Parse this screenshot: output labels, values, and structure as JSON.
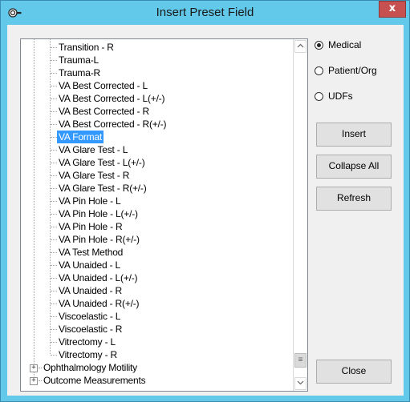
{
  "window": {
    "title": "Insert Preset Field",
    "icon": "key-icon",
    "close_label": "x"
  },
  "tree": {
    "items": [
      {
        "label": "Transition - R",
        "level": 2,
        "selected": false
      },
      {
        "label": "Trauma-L",
        "level": 2,
        "selected": false
      },
      {
        "label": "Trauma-R",
        "level": 2,
        "selected": false
      },
      {
        "label": "VA Best Corrected - L",
        "level": 2,
        "selected": false
      },
      {
        "label": "VA Best Corrected - L(+/-)",
        "level": 2,
        "selected": false
      },
      {
        "label": "VA Best Corrected - R",
        "level": 2,
        "selected": false
      },
      {
        "label": "VA Best Corrected - R(+/-)",
        "level": 2,
        "selected": false
      },
      {
        "label": "VA Format",
        "level": 2,
        "selected": true
      },
      {
        "label": "VA Glare Test - L",
        "level": 2,
        "selected": false
      },
      {
        "label": "VA Glare Test - L(+/-)",
        "level": 2,
        "selected": false
      },
      {
        "label": "VA Glare Test - R",
        "level": 2,
        "selected": false
      },
      {
        "label": "VA Glare Test - R(+/-)",
        "level": 2,
        "selected": false
      },
      {
        "label": "VA Pin Hole - L",
        "level": 2,
        "selected": false
      },
      {
        "label": "VA Pin Hole - L(+/-)",
        "level": 2,
        "selected": false
      },
      {
        "label": "VA Pin Hole - R",
        "level": 2,
        "selected": false
      },
      {
        "label": "VA Pin Hole - R(+/-)",
        "level": 2,
        "selected": false
      },
      {
        "label": "VA Test Method",
        "level": 2,
        "selected": false
      },
      {
        "label": "VA Unaided - L",
        "level": 2,
        "selected": false
      },
      {
        "label": "VA Unaided - L(+/-)",
        "level": 2,
        "selected": false
      },
      {
        "label": "VA Unaided - R",
        "level": 2,
        "selected": false
      },
      {
        "label": "VA Unaided - R(+/-)",
        "level": 2,
        "selected": false
      },
      {
        "label": "Viscoelastic - L",
        "level": 2,
        "selected": false
      },
      {
        "label": "Viscoelastic - R",
        "level": 2,
        "selected": false
      },
      {
        "label": "Vitrectomy - L",
        "level": 2,
        "selected": false
      },
      {
        "label": "Vitrectomy - R",
        "level": 2,
        "selected": false
      },
      {
        "label": "Ophthalmology Motility",
        "level": 1,
        "expander": "+",
        "selected": false
      },
      {
        "label": "Outcome Measurements",
        "level": 1,
        "expander": "+",
        "selected": false
      }
    ],
    "scrollbar": {
      "up_glyph": "^",
      "down_glyph": "v",
      "thumb_glyph": "≡",
      "scroll_position": 0.97
    }
  },
  "options": {
    "radios": [
      {
        "label": "Medical",
        "checked": true
      },
      {
        "label": "Patient/Org",
        "checked": false
      },
      {
        "label": "UDFs",
        "checked": false
      }
    ]
  },
  "buttons": {
    "insert": "Insert",
    "collapse_all": "Collapse All",
    "refresh": "Refresh",
    "close": "Close"
  }
}
